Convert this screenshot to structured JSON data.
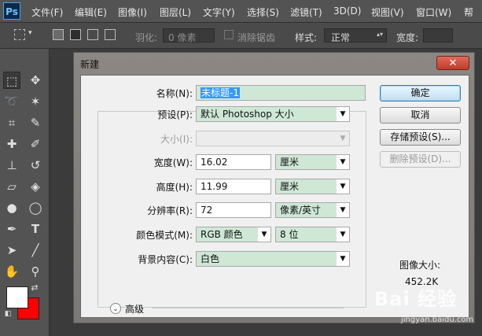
{
  "app": {
    "logo": "Ps"
  },
  "menu": [
    "文件(F)",
    "编辑(E)",
    "图像(I)",
    "图层(L)",
    "文字(Y)",
    "选择(S)",
    "滤镜(T)",
    "3D(D)",
    "视图(V)",
    "窗口(W)",
    "帮"
  ],
  "options": {
    "feather_label": "羽化:",
    "feather_value": "0 像素",
    "antialias_label": "消除锯齿",
    "style_label": "样式:",
    "style_value": "正常",
    "width_label": "宽度:"
  },
  "tools": [
    "rect-marquee-icon",
    "move-icon",
    "lasso-icon",
    "magic-wand-icon",
    "crop-icon",
    "eyedropper-icon",
    "healing-brush-icon",
    "brush-icon",
    "clone-stamp-icon",
    "history-brush-icon",
    "eraser-icon",
    "paint-bucket-icon",
    "blur-icon",
    "dodge-icon",
    "pen-icon",
    "type-icon",
    "path-select-icon",
    "line-icon",
    "hand-icon",
    "zoom-icon"
  ],
  "colors": {
    "foreground": "#ffffff",
    "background": "#ff0000",
    "accent": "#3399ff"
  },
  "dialog": {
    "title": "新建",
    "close": "✕",
    "name_label": "名称(N):",
    "name_value": "未标题-1",
    "preset_label": "预设(P):",
    "preset_value": "默认 Photoshop 大小",
    "size_label": "大小(I):",
    "size_value": "",
    "width_label": "宽度(W):",
    "width_value": "16.02",
    "width_unit": "厘米",
    "height_label": "高度(H):",
    "height_value": "11.99",
    "height_unit": "厘米",
    "resolution_label": "分辨率(R):",
    "resolution_value": "72",
    "resolution_unit": "像素/英寸",
    "color_mode_label": "颜色模式(M):",
    "color_mode_value": "RGB 颜色",
    "bit_depth_value": "8 位",
    "background_label": "背景内容(C):",
    "background_value": "白色",
    "advanced_label": "高级",
    "ok": "确定",
    "cancel": "取消",
    "save_preset": "存储预设(S)...",
    "delete_preset": "删除预设(D)...",
    "image_size_label": "图像大小:",
    "image_size_value": "452.2K"
  },
  "watermark": {
    "main": "Bai 经验",
    "sub": "jingyan.baidu.com"
  }
}
